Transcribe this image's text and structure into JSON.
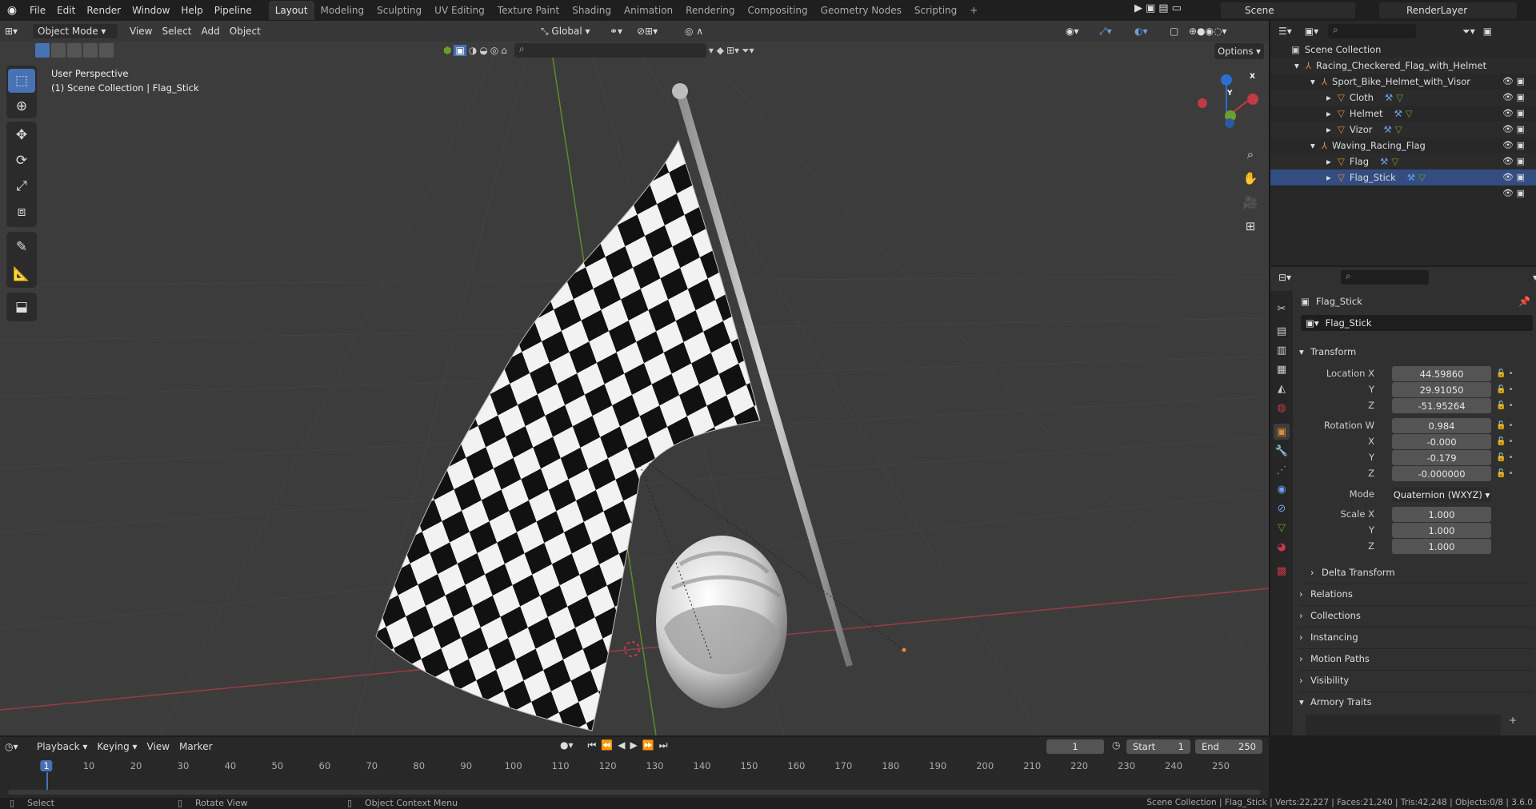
{
  "topbar": {
    "menus": [
      "File",
      "Edit",
      "Render",
      "Window",
      "Help",
      "Pipeline"
    ],
    "workspaces": [
      "Layout",
      "Modeling",
      "Sculpting",
      "UV Editing",
      "Texture Paint",
      "Shading",
      "Animation",
      "Rendering",
      "Compositing",
      "Geometry Nodes",
      "Scripting"
    ],
    "active_workspace": "Layout",
    "add_tab": "+",
    "scene_name": "Scene",
    "view_layer": "RenderLayer"
  },
  "viewport": {
    "mode": "Object Mode",
    "menus": [
      "View",
      "Select",
      "Add",
      "Object"
    ],
    "transform_orientation": "Global",
    "options_label": "Options",
    "overlay_text_1": "User Perspective",
    "overlay_text_2": "(1) Scene Collection | Flag_Stick",
    "gizmo_x": "X",
    "gizmo_y": "Y",
    "gizmo_z": "Z"
  },
  "outliner": {
    "root": "Scene Collection",
    "rows": [
      {
        "label": "Racing_Checkered_Flag_with_Helmet",
        "type": "empty"
      },
      {
        "label": "Sport_Bike_Helmet_with_Visor",
        "type": "empty"
      },
      {
        "label": "Cloth",
        "type": "mesh"
      },
      {
        "label": "Helmet",
        "type": "mesh"
      },
      {
        "label": "Vizor",
        "type": "mesh"
      },
      {
        "label": "Waving_Racing_Flag",
        "type": "empty"
      },
      {
        "label": "Flag",
        "type": "mesh"
      },
      {
        "label": "Flag_Stick",
        "type": "mesh"
      }
    ]
  },
  "properties": {
    "object_name": "Flag_Stick",
    "data_name": "Flag_Stick",
    "transform_header": "Transform",
    "location_label": "Location X",
    "location": [
      "44.59860",
      "29.91050",
      "-51.95264"
    ],
    "rotation_label": "Rotation W",
    "rotation": [
      "0.984",
      "-0.000",
      "-0.179",
      "-0.000000"
    ],
    "mode_label": "Mode",
    "mode_value": "Quaternion (WXYZ)",
    "scale_label": "Scale X",
    "scale": [
      "1.000",
      "1.000",
      "1.000"
    ],
    "axis_y": "Y",
    "axis_z": "Z",
    "axis_x": "X",
    "sections": [
      "Delta Transform",
      "Relations",
      "Collections",
      "Instancing",
      "Motion Paths",
      "Visibility",
      "Armory Traits"
    ]
  },
  "timeline": {
    "menus": [
      "Playback",
      "Keying",
      "View",
      "Marker"
    ],
    "current_frame": "1",
    "start_label": "Start",
    "start": "1",
    "end_label": "End",
    "end": "250",
    "ticks": [
      "1",
      "10",
      "20",
      "30",
      "40",
      "50",
      "60",
      "70",
      "80",
      "90",
      "100",
      "110",
      "120",
      "130",
      "140",
      "150",
      "160",
      "170",
      "180",
      "190",
      "200",
      "210",
      "220",
      "230",
      "240",
      "250"
    ]
  },
  "statusbar": {
    "select": "Select",
    "rotate": "Rotate View",
    "context": "Object Context Menu",
    "stats": "Scene Collection | Flag_Stick | Verts:22,227 | Faces:21,240 | Tris:42,248 | Objects:0/8 | 3.6.0"
  },
  "colors": {
    "accent": "#4772b3",
    "x_axis": "#c23a44",
    "y_axis": "#6c9e2a",
    "z_axis": "#2c6ecf",
    "object_orange": "#e08b3a"
  }
}
